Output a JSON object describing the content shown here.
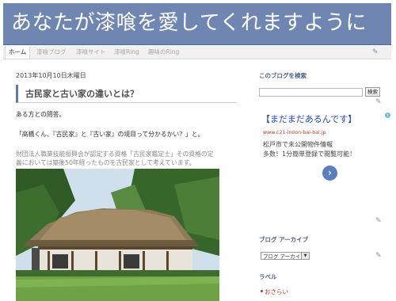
{
  "header": {
    "title": "あなたが漆喰を愛してくれますように"
  },
  "tabs": [
    {
      "label": "ホーム"
    },
    {
      "label": "漆喰ブログ"
    },
    {
      "label": "漆喰サイト"
    },
    {
      "label": "漆喰Ring"
    },
    {
      "label": "趣味のRing"
    }
  ],
  "post": {
    "date": "2013年10月10日木曜日",
    "title": "古民家と古い家の違いとは？",
    "paragraphs": [
      "ある方との問答。",
      "「高橋くん、『古民家』と『古い家』の境目って分かるかい？」と。",
      "財団法人職業技能振興会が認定する資格「古民家鑑定士」その資格の定",
      "義においては築後50年経ったものを古民家として考えています。"
    ]
  },
  "sidebar": {
    "search_heading": "このブログを検索",
    "search_button": "検索",
    "ad": {
      "headline": "【まだまだあるんです】",
      "url": "www.c21-inoon-bai-bai.jp",
      "line1": "松戸市で未公開物件情報",
      "line2": "多数！1分簡単登録で閲覧可能！"
    },
    "archive_heading": "ブログ アーカイブ",
    "archive_select": "ブログ アーカイブ",
    "labels_heading": "ラベル",
    "labels": [
      "おさらい"
    ]
  },
  "colors": {
    "header_bg": "#6f86b3",
    "accent": "#5b7bb6",
    "link": "#1f47c4",
    "label_red": "#c0392b"
  }
}
